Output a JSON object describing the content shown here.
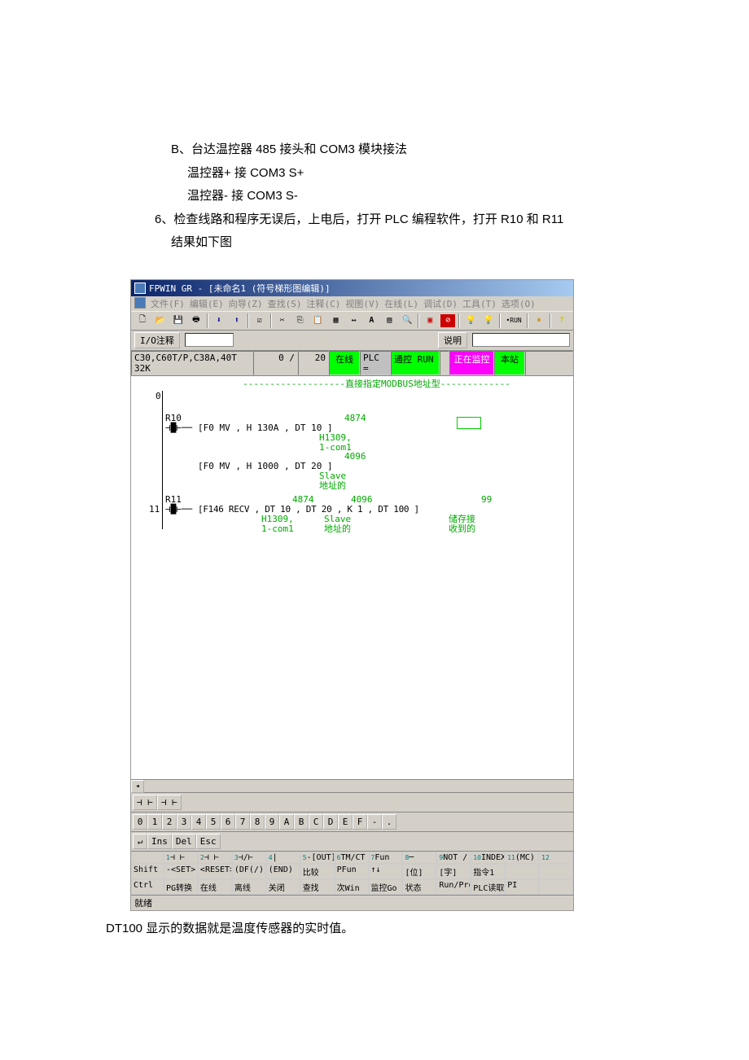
{
  "doc": {
    "lineB": "B、台达温控器 485 接头和 COM3 模块接法",
    "lineB1": "温控器+ 接  COM3 S+",
    "lineB2": "温控器- 接  COM3 S-",
    "line6": "6、检查线路和程序无误后，上电后，打开 PLC 编程软件，打开 R10 和 R11",
    "line6b": "结果如下图",
    "caption": "DT100 显示的数据就是温度传感器的实时值。"
  },
  "app": {
    "title": "FPWIN GR - [未命名1  (符号梯形图编辑)]",
    "menu": {
      "file": "文件(F)",
      "edit": "编辑(E)",
      "wizard": "向导(Z)",
      "find": "查找(S)",
      "comment": "注释(C)",
      "view": "视图(V)",
      "online": "在线(L)",
      "debug": "调试(D)",
      "tools": "工具(T)",
      "option": "选项(O)"
    },
    "toolbar2": {
      "io_label": "I/O注释",
      "desc_label": "说明"
    },
    "status": {
      "plc_type": "C30,C60T/P,C38A,40T 32K",
      "step": "0 /",
      "total": "20",
      "online": "在线",
      "plc_eq": "PLC =",
      "mode": "通控 RUN",
      "monitor": "正在监控",
      "station": "本站"
    },
    "ladder": {
      "header": "直接指定MODBUS地址型",
      "rung0_num": "0",
      "r10": "R10",
      "f0_1": "[F0 MV     ,   H 130A   ,   DT 10    ]",
      "val1": "4874",
      "note1a": "H1309,",
      "note1b": "1-com1",
      "f0_2": "[F0 MV     ,   H 1000   ,   DT 20    ]",
      "val2": "4096",
      "note2a": "Slave",
      "note2b": "地址的",
      "rung11_num": "11",
      "r11": "R11",
      "f146": "[F146 RECV  ,   DT 10    ,   DT 20    ,   K 1      ,   DT 100   ]",
      "val3a": "4874",
      "val3b": "4096",
      "val3c": "99",
      "note3a": "H1309,",
      "note3b": "1-com1",
      "note3c": "Slave",
      "note3d": "地址的",
      "note3e": "储存接",
      "note3f": "收到的"
    },
    "hexbar": [
      "0",
      "1",
      "2",
      "3",
      "4",
      "5",
      "6",
      "7",
      "8",
      "9",
      "A",
      "B",
      "C",
      "D",
      "E",
      "F",
      "-",
      "."
    ],
    "editbar": [
      "↵",
      "Ins",
      "Del",
      "Esc"
    ],
    "fkeys": {
      "row1_label": "",
      "row1": [
        "⊣ ⊢",
        "⊣ ⊢",
        "⊣/⊢",
        "|",
        "-[OUT]",
        "TM/CT",
        "Fun",
        "─",
        "NOT /",
        "INDEX",
        "(MC)",
        ""
      ],
      "row2_label": "Shift",
      "row2": [
        "-<SET>",
        "<RESET>",
        "(DF(/))",
        "(END)",
        "比较",
        "PFun",
        "↑↓",
        "[位]",
        "[字]",
        "指令1",
        ""
      ],
      "row3_label": "Ctrl",
      "row3": [
        "PG转换",
        "在线",
        "离线",
        "关闭",
        "查找",
        "次Win",
        "监控Go",
        "状态",
        "Run/Prog",
        "PLC读取",
        "PI"
      ],
      "nums": [
        "1",
        "2",
        "3",
        "4",
        "5",
        "6",
        "7",
        "8",
        "9",
        "10",
        "11",
        "12"
      ]
    },
    "statusbar": "就绪"
  }
}
